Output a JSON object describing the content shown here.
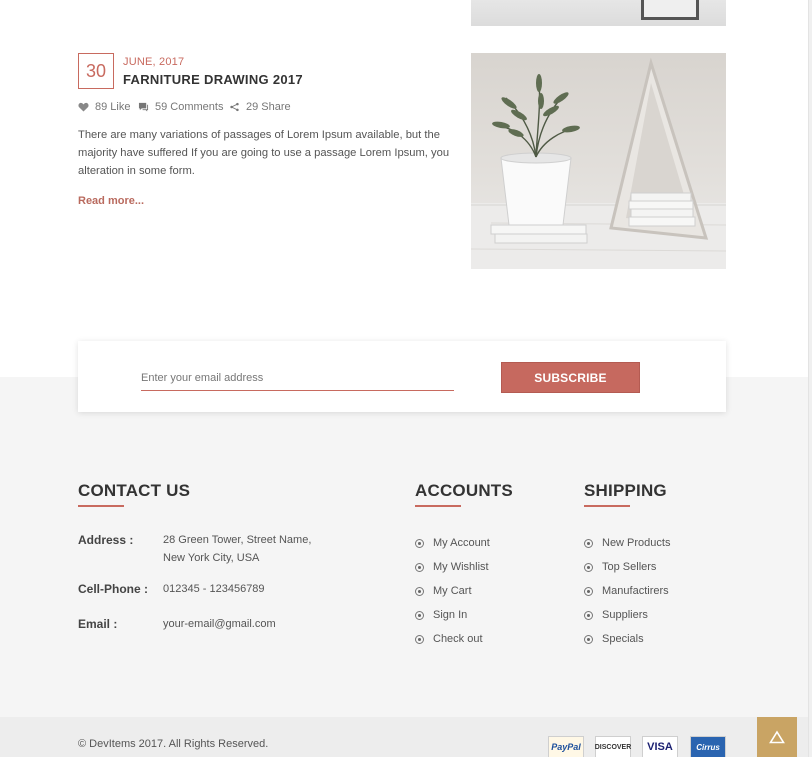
{
  "post": {
    "day": "30",
    "month_year": "JUNE, 2017",
    "title": "FARNITURE DRAWING 2017",
    "likes": "89 Like",
    "comments": "59 Comments",
    "shares": "29 Share",
    "excerpt": "There are many variations of passages of Lorem Ipsum available, but the majority have suffered If you are going to use a passage Lorem Ipsum, you alteration in some form.",
    "read_more": "Read more..."
  },
  "newsletter": {
    "placeholder": "Enter your email address",
    "button": "SUBSCRIBE"
  },
  "contact": {
    "title": "CONTACT US",
    "address_label": "Address :",
    "address_line1": "28 Green Tower, Street Name,",
    "address_line2": "New York City, USA",
    "phone_label": "Cell-Phone :",
    "phone": "012345 - 123456789",
    "email_label": "Email :",
    "email": "your-email@gmail.com"
  },
  "accounts": {
    "title": "ACCOUNTS",
    "items": [
      "My Account",
      "My Wishlist",
      "My Cart",
      "Sign In",
      "Check out"
    ]
  },
  "shipping": {
    "title": "SHIPPING",
    "items": [
      "New Products",
      "Top Sellers",
      "Manufactirers",
      "Suppliers",
      "Specials"
    ]
  },
  "footer": {
    "copyright": "© DevItems 2017. All Rights Reserved.",
    "payments": [
      "PayPal",
      "DISCOVER",
      "VISA",
      "Cirrus"
    ]
  },
  "colors": {
    "accent": "#c6695f",
    "to_top": "#c9a464"
  },
  "icons": {
    "like": "heart-icon",
    "comments": "comment-icon",
    "share": "share-icon",
    "to_top": "arrow-up-icon"
  }
}
